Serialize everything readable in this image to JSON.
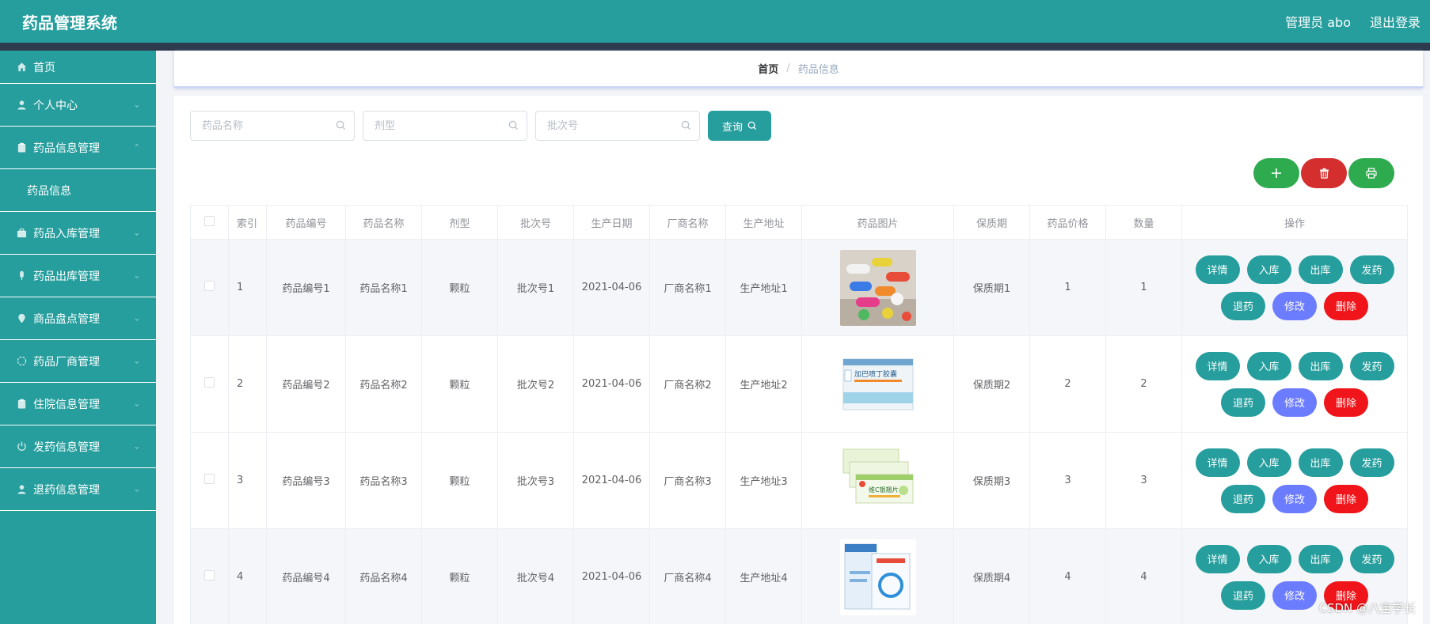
{
  "app": {
    "title": "药品管理系统",
    "user": "管理员 abo",
    "logout": "退出登录"
  },
  "sidebar": {
    "items": [
      {
        "label": "首页",
        "icon": "home-icon"
      },
      {
        "label": "个人中心",
        "icon": "user-icon"
      },
      {
        "label": "药品信息管理",
        "icon": "clipboard-icon",
        "expanded": true,
        "sub": "药品信息"
      },
      {
        "label": "药品入库管理",
        "icon": "briefcase-icon"
      },
      {
        "label": "药品出库管理",
        "icon": "mic-icon"
      },
      {
        "label": "商品盘点管理",
        "icon": "location-icon"
      },
      {
        "label": "药品厂商管理",
        "icon": "globe-icon"
      },
      {
        "label": "住院信息管理",
        "icon": "clipboard-icon"
      },
      {
        "label": "发药信息管理",
        "icon": "power-icon"
      },
      {
        "label": "退药信息管理",
        "icon": "user-icon"
      }
    ]
  },
  "breadcrumb": {
    "home": "首页",
    "current": "药品信息"
  },
  "search": {
    "name_placeholder": "药品名称",
    "type_placeholder": "剂型",
    "batch_placeholder": "批次号",
    "query_label": "查询"
  },
  "table": {
    "headers": [
      "索引",
      "药品编号",
      "药品名称",
      "剂型",
      "批次号",
      "生产日期",
      "厂商名称",
      "生产地址",
      "药品图片",
      "保质期",
      "药品价格",
      "数量",
      "操作"
    ],
    "rows": [
      {
        "index": "1",
        "code": "药品编号1",
        "name": "药品名称1",
        "form": "颗粒",
        "batch": "批次号1",
        "date": "2021-04-06",
        "maker": "厂商名称1",
        "address": "生产地址1",
        "shelf": "保质期1",
        "price": "1",
        "qty": "1"
      },
      {
        "index": "2",
        "code": "药品编号2",
        "name": "药品名称2",
        "form": "颗粒",
        "batch": "批次号2",
        "date": "2021-04-06",
        "maker": "厂商名称2",
        "address": "生产地址2",
        "shelf": "保质期2",
        "price": "2",
        "qty": "2",
        "img_text": "加巴喷丁胶囊"
      },
      {
        "index": "3",
        "code": "药品编号3",
        "name": "药品名称3",
        "form": "颗粒",
        "batch": "批次号3",
        "date": "2021-04-06",
        "maker": "厂商名称3",
        "address": "生产地址3",
        "shelf": "保质期3",
        "price": "3",
        "qty": "3",
        "img_text": "维C银翘片"
      },
      {
        "index": "4",
        "code": "药品编号4",
        "name": "药品名称4",
        "form": "颗粒",
        "batch": "批次号4",
        "date": "2021-04-06",
        "maker": "厂商名称4",
        "address": "生产地址4",
        "shelf": "保质期4",
        "price": "4",
        "qty": "4"
      }
    ],
    "actions": [
      "详情",
      "入库",
      "出库",
      "发药",
      "退药",
      "修改",
      "删除"
    ]
  },
  "watermark": "CSDN @八宝学长",
  "colors": {
    "primary": "#259e9d",
    "danger": "#f0151a",
    "edit": "#6c7cff",
    "success": "#2fab4f"
  }
}
